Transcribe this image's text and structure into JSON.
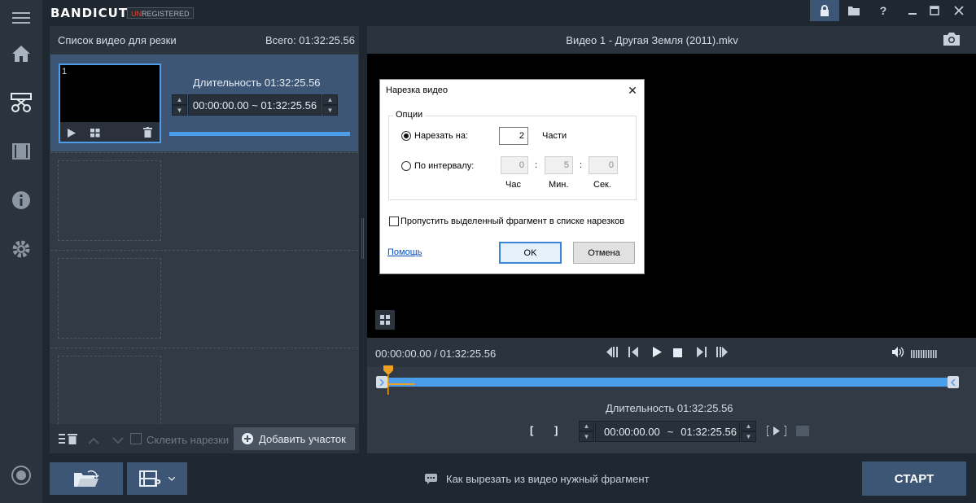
{
  "app": {
    "logo": "BANDICUT",
    "badge_un": "UN",
    "badge_rest": "REGISTERED"
  },
  "left_panel": {
    "title": "Список видео для резки",
    "total": "Всего: 01:32:25.56",
    "segment": {
      "number": "1",
      "duration_label": "Длительность 01:32:25.56",
      "range": "00:00:00.00  ~  01:32:25.56"
    },
    "join_label": "Склеить нарезки",
    "add_label": "Добавить участок"
  },
  "video": {
    "title": "Видео 1 - Другая Земля (2011).mkv",
    "time": "00:00:00.00 / 01:32:25.56",
    "duration_label": "Длительность 01:32:25.56",
    "start": "00:00:00.00",
    "separator": "~",
    "end": "01:32:25.56"
  },
  "bottom": {
    "hint": "Как вырезать из видео нужный фрагмент",
    "start_label": "СТАРТ"
  },
  "dialog": {
    "title": "Нарезка видео",
    "group_label": "Опции",
    "cut_into_label": "Нарезать на:",
    "cut_into_value": "2",
    "parts_label": "Части",
    "interval_label": "По интервалу:",
    "hours_value": "0",
    "minutes_value": "5",
    "seconds_value": "0",
    "colon": ":",
    "hours_label": "Час",
    "minutes_label": "Мин.",
    "seconds_label": "Сек.",
    "skip_label": "Пропустить выделенный фрагмент в списке нарезков",
    "help_label": "Помощь",
    "ok_label": "OK",
    "cancel_label": "Отмена"
  },
  "colors": {
    "accent": "#4b9ee9",
    "selected": "#3e5675",
    "marker": "#f0a020"
  }
}
